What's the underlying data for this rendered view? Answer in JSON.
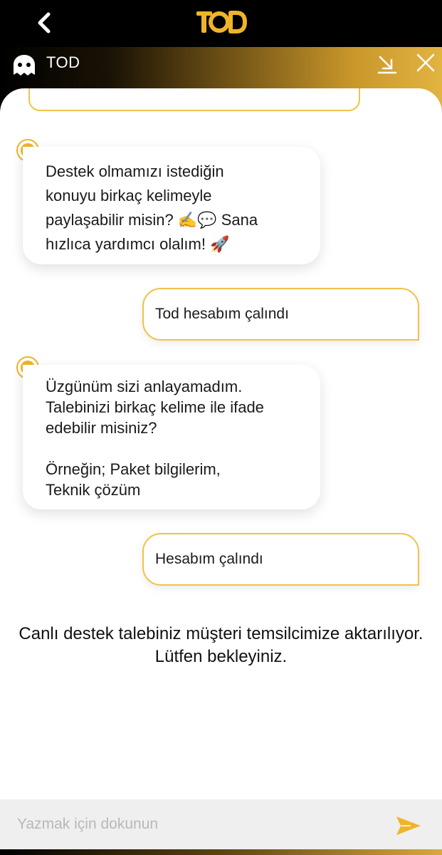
{
  "app_bar": {
    "logo_text": "TOD",
    "accent_color": "#f0b429"
  },
  "chat_header": {
    "title": "TOD"
  },
  "messages": [
    {
      "sender": "bot",
      "text": "Destek olmamızı istediğin\nkonuyu birkaç kelimeyle\npaylaşabilir misin? ✍️💬 Sana\nhızlıca yardımcı olalım! 🚀"
    },
    {
      "sender": "user",
      "text": "Tod hesabım çalındı"
    },
    {
      "sender": "bot",
      "text": "Üzgünüm sizi anlayamadım.\nTalebinizi birkaç kelime ile ifade\nedebilir misiniz?\n\nÖrneğin; Paket bilgilerim,\nTeknik çözüm"
    },
    {
      "sender": "user",
      "text": "Hesabım çalındı"
    }
  ],
  "system_message": "Canlı destek talebiniz müşteri temsilcimize aktarılıyor. Lütfen bekleyiniz.",
  "input": {
    "placeholder": "Yazmak için dokunun",
    "value": ""
  },
  "icons": {
    "back": "chevron-left-icon",
    "bot": "ghost-bot-icon",
    "minimize": "minimize-download-icon",
    "close": "close-icon",
    "send": "send-icon"
  }
}
